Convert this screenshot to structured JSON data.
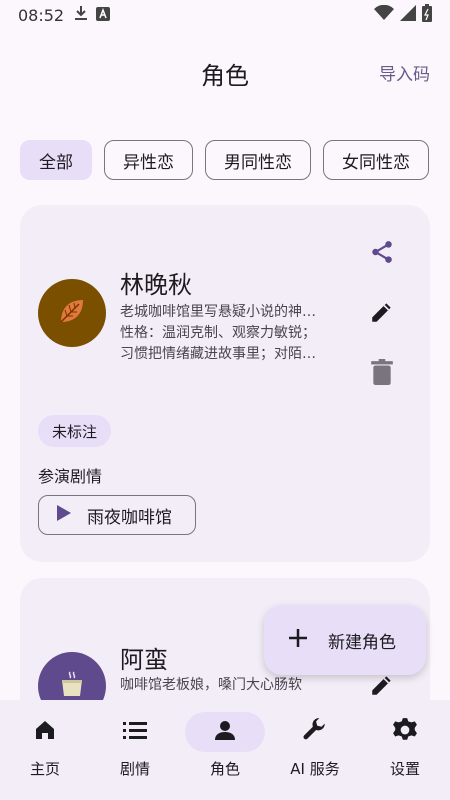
{
  "status_bar": {
    "time": "08:52",
    "icons": [
      "download-icon",
      "a-box-icon",
      "wifi-icon",
      "signal-icon",
      "battery-icon"
    ]
  },
  "header": {
    "title": "角色",
    "import_label": "导入码"
  },
  "filters": [
    {
      "label": "全部",
      "selected": true
    },
    {
      "label": "异性恋",
      "selected": false
    },
    {
      "label": "男同性恋",
      "selected": false
    },
    {
      "label": "女同性恋",
      "selected": false
    }
  ],
  "characters": [
    {
      "name": "林晚秋",
      "avatar_icon": "autumn-leaf-icon",
      "avatar_color": "#7a4f00",
      "desc_lines": [
        "老城咖啡馆里写悬疑小说的神…",
        "性格：温润克制、观察力敏锐；",
        "习惯把情绪藏进故事里；对陌…"
      ],
      "tag": "未标注",
      "section_label": "参演剧情",
      "story": "雨夜咖啡馆"
    },
    {
      "name": "阿蛮",
      "avatar_icon": "tea-cup-icon",
      "avatar_color": "#5e4a8c",
      "desc_lines": [
        "咖啡馆老板娘，嗓门大心肠软"
      ]
    }
  ],
  "fab": {
    "label": "新建角色"
  },
  "bottom_nav": [
    {
      "label": "主页",
      "icon": "home-icon",
      "active": false
    },
    {
      "label": "剧情",
      "icon": "list-icon",
      "active": false
    },
    {
      "label": "角色",
      "icon": "person-icon",
      "active": true
    },
    {
      "label": "AI 服务",
      "icon": "wrench-icon",
      "active": false
    },
    {
      "label": "设置",
      "icon": "gear-icon",
      "active": false
    }
  ],
  "colors": {
    "accent": "#e8def8",
    "primary_icon": "#5e4a8c",
    "background": "#fcf7fd"
  }
}
